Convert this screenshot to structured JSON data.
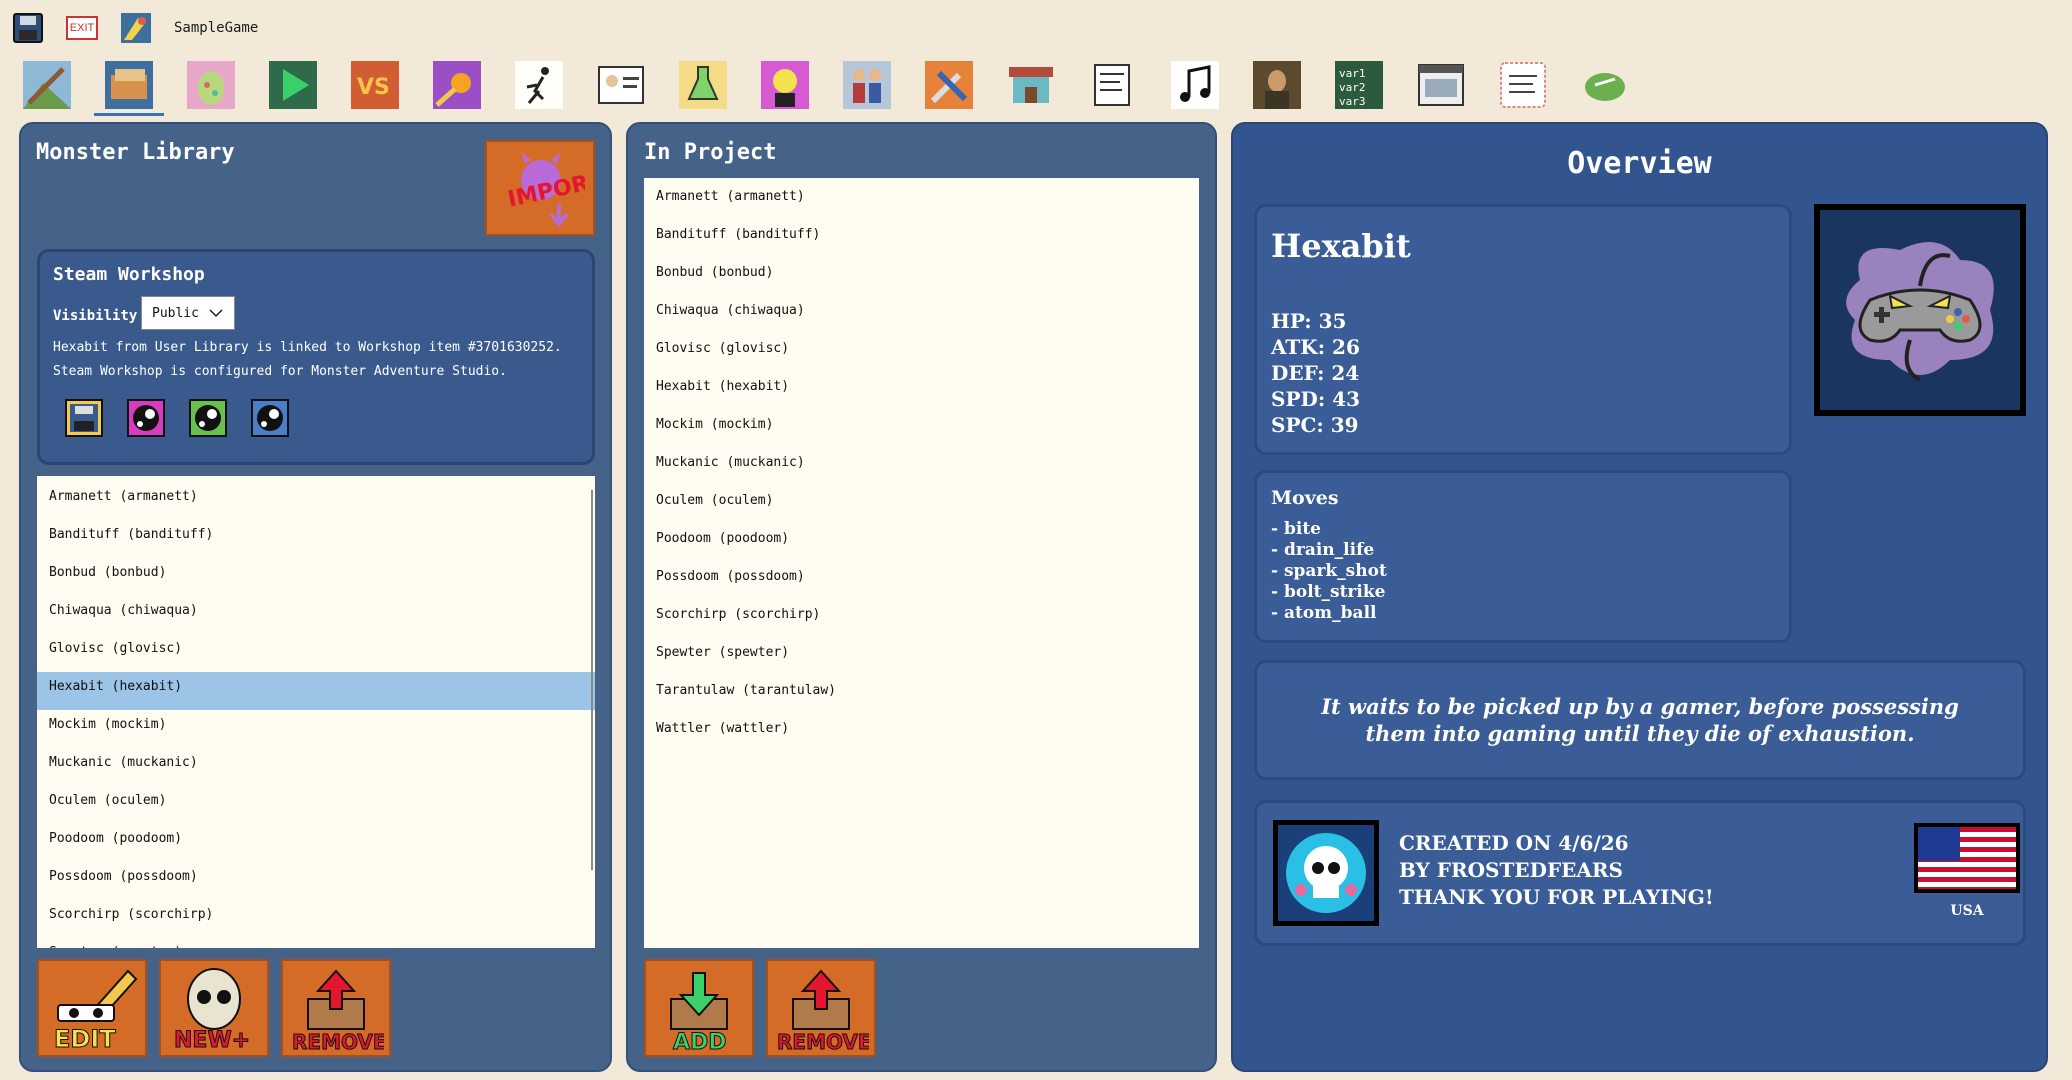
{
  "app": {
    "project_name": "SampleGame"
  },
  "topbar": {
    "save_icon": "floppy-disk-icon",
    "exit_label": "EXIT",
    "project_icon": "game-project-icon"
  },
  "toolbar": {
    "tools": [
      "map-editor-icon",
      "monster-library-icon",
      "egg-icon",
      "play-icon",
      "versus-icon",
      "fire-move-icon",
      "runner-icon",
      "id-card-icon",
      "potion-icon",
      "character-icon",
      "npc-icon",
      "tools-icon",
      "shop-icon",
      "script-icon",
      "music-icon",
      "painting-icon",
      "variables-icon",
      "window-icon",
      "dialog-icon",
      "export-icon"
    ],
    "active_index": 1
  },
  "library": {
    "title": "Monster Library",
    "import_label": "IMPORT",
    "workshop": {
      "title": "Steam Workshop",
      "visibility_label": "Visibility",
      "visibility_value": "Public",
      "line1": "Hexabit from User Library is linked to Workshop item #3701630252.",
      "line2": "Steam Workshop is configured for Monster Adventure Studio."
    },
    "items": [
      "Armanett (armanett)",
      "Bandituff (bandituff)",
      "Bonbud (bonbud)",
      "Chiwaqua (chiwaqua)",
      "Glovisc (glovisc)",
      "Hexabit (hexabit)",
      "Mockim (mockim)",
      "Muckanic (muckanic)",
      "Oculem (oculem)",
      "Poodoom (poodoom)",
      "Possdoom (possdoom)",
      "Scorchirp (scorchirp)",
      "Spewter (spewter)"
    ],
    "selected_index": 5,
    "edit_label": "EDIT",
    "new_label": "NEW+",
    "remove_label": "REMOVE"
  },
  "project": {
    "title": "In Project",
    "items": [
      "Armanett (armanett)",
      "Bandituff (bandituff)",
      "Bonbud (bonbud)",
      "Chiwaqua (chiwaqua)",
      "Glovisc (glovisc)",
      "Hexabit (hexabit)",
      "Mockim (mockim)",
      "Muckanic (muckanic)",
      "Oculem (oculem)",
      "Poodoom (poodoom)",
      "Possdoom (possdoom)",
      "Scorchirp (scorchirp)",
      "Spewter (spewter)",
      "Tarantulaw (tarantulaw)",
      "Wattler (wattler)"
    ],
    "add_label": "ADD",
    "remove_label": "REMOVE"
  },
  "overview": {
    "title": "Overview",
    "name": "Hexabit",
    "stats": {
      "hp": "HP: 35",
      "atk": "ATK: 26",
      "def": "DEF: 24",
      "spd": "SPD: 43",
      "spc": "SPC: 39"
    },
    "moves_title": "Moves",
    "moves": [
      "- bite",
      "- drain_life",
      "- spark_shot",
      "- bolt_strike",
      "- atom_ball"
    ],
    "description": "It waits to be picked up by a gamer, before possessing them into gaming until they die of exhaustion.",
    "credit": {
      "line1": "CREATED ON 4/6/26",
      "line2": "BY FROSTEDFEARS",
      "line3": "THANK YOU FOR PLAYING!",
      "country": "USA"
    }
  }
}
